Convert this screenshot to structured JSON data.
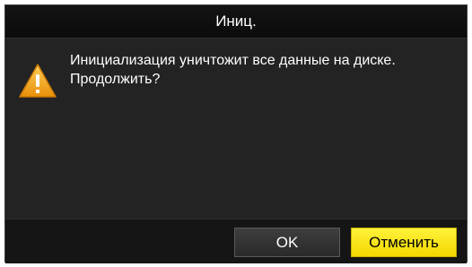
{
  "dialog": {
    "title": "Иниц.",
    "icon": "warning-icon",
    "message_line1": "Инициализация уничтожит все данные на диске.",
    "message_line2": "Продолжить?",
    "ok_label": "OK",
    "cancel_label": "Отменить"
  },
  "colors": {
    "background": "#232323",
    "footer": "#151515",
    "accent_button": "#f9e400",
    "warning": "#f2a51c"
  }
}
